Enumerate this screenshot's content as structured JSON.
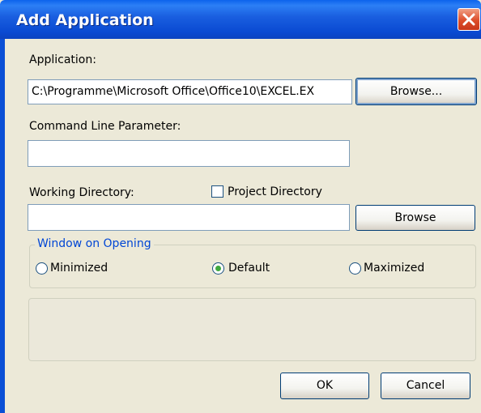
{
  "window": {
    "title": "Add Application"
  },
  "application": {
    "label": "Application:",
    "value": "C:\\Programme\\Microsoft Office\\Office10\\EXCEL.EX",
    "browse_label": "Browse..."
  },
  "command_line": {
    "label": "Command Line Parameter:",
    "value": ""
  },
  "working_dir": {
    "label": "Working Directory:",
    "value": "",
    "project_dir_label": "Project Directory",
    "project_dir_checked": false,
    "browse_label": "Browse"
  },
  "window_opening": {
    "legend": "Window on Opening",
    "options": [
      {
        "label": "Minimized",
        "selected": false
      },
      {
        "label": "Default",
        "selected": true
      },
      {
        "label": "Maximized",
        "selected": false
      }
    ]
  },
  "buttons": {
    "ok_label": "OK",
    "cancel_label": "Cancel"
  },
  "colors": {
    "title_bar": "#0a4ad2",
    "legend_text": "#0046d5",
    "close_button": "#dd4d2a"
  }
}
